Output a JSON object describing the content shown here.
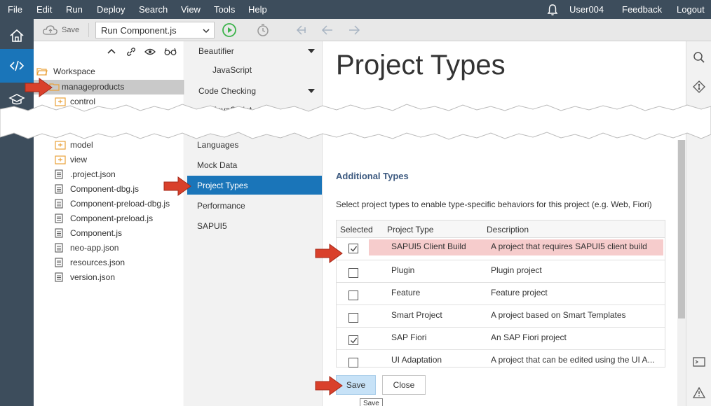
{
  "menu": {
    "items": [
      "File",
      "Edit",
      "Run",
      "Deploy",
      "Search",
      "View",
      "Tools",
      "Help"
    ],
    "user": "User004",
    "feedback": "Feedback",
    "logout": "Logout"
  },
  "toolbar": {
    "save_label": "Save",
    "run_select_value": "Run Component.js"
  },
  "tree": {
    "root": "Workspace",
    "project": "manageproducts",
    "folders": [
      "control",
      "model",
      "view"
    ],
    "files": [
      ".project.json",
      "Component-dbg.js",
      "Component-preload-dbg.js",
      "Component-preload.js",
      "Component.js",
      "neo-app.json",
      "resources.json",
      "version.json"
    ]
  },
  "settings_nav": {
    "beautifier": "Beautifier",
    "beautifier_js": "JavaScript",
    "code_checking": "Code Checking",
    "code_checking_js": "JavaScript",
    "languages": "Languages",
    "mock_data": "Mock Data",
    "project_types": "Project Types",
    "performance": "Performance",
    "sapui5": "SAPUI5"
  },
  "main": {
    "title": "Project Types",
    "additional_types_title": "Additional Types",
    "description": "Select project types to enable type-specific behaviors for this project (e.g. Web, Fiori)",
    "columns": [
      "Selected",
      "Project Type",
      "Description"
    ],
    "rows": [
      {
        "type": "SAPUI5 Client Build",
        "description": "A project that requires SAPUI5 client build",
        "selected": true
      },
      {
        "type": "Plugin",
        "description": "Plugin project",
        "selected": false
      },
      {
        "type": "Feature",
        "description": "Feature project",
        "selected": false
      },
      {
        "type": "Smart Project",
        "description": "A project based on Smart Templates",
        "selected": false
      },
      {
        "type": "SAP Fiori",
        "description": "An SAP Fiori project",
        "selected": true
      },
      {
        "type": "UI Adaptation",
        "description": "A project that can be edited using the UI A...",
        "selected": false
      }
    ],
    "save_button": "Save",
    "close_button": "Close",
    "tooltip": "Save"
  },
  "colors": {
    "shell": "#3d4d5c",
    "accent": "#1a75b9",
    "highlight_row": "#f6cccc",
    "arrow": "#d9402b"
  }
}
